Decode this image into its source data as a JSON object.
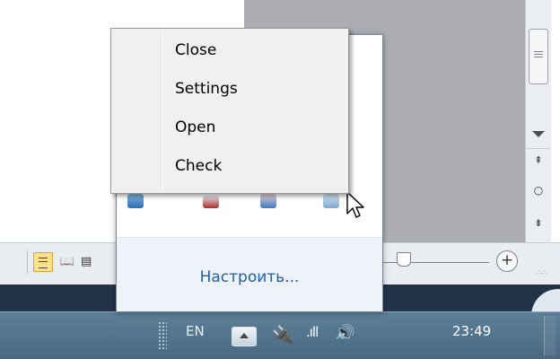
{
  "context_menu": {
    "items": [
      {
        "label": "Close"
      },
      {
        "label": "Settings"
      },
      {
        "label": "Open"
      },
      {
        "label": "Check"
      }
    ]
  },
  "tray_popup": {
    "customize_link": "Настроить...",
    "icons": [
      "app-tray-icon",
      "red-tray-icon",
      "blue-tray-icon",
      "network-tray-icon"
    ]
  },
  "scrollbar": {
    "browse_up": "⇞",
    "browse_object": "○",
    "browse_down": "⇟"
  },
  "statusbar": {
    "zoom_plus": "+"
  },
  "taskbar": {
    "language": "EN",
    "clock": "23:49",
    "power_icon": "power-plug-icon",
    "signal_icon": "signal-bars-icon",
    "volume_icon": "speaker-icon"
  }
}
